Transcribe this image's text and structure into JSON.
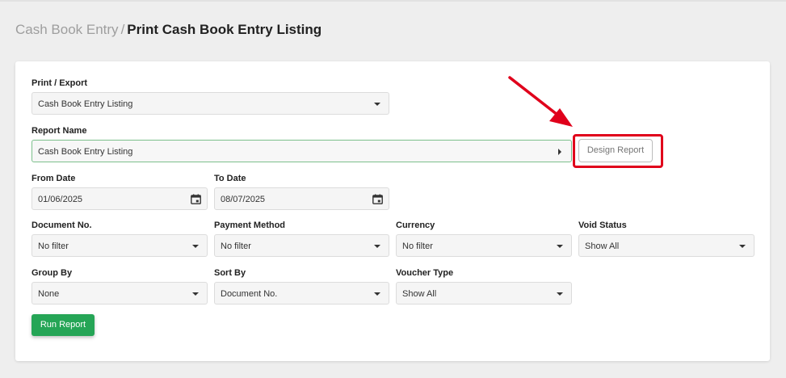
{
  "breadcrumb": {
    "parent": "Cash Book Entry",
    "separator": "/",
    "current": "Print Cash Book Entry Listing"
  },
  "form": {
    "print_export": {
      "label": "Print / Export",
      "value": "Cash Book Entry Listing"
    },
    "report_name": {
      "label": "Report Name",
      "value": "Cash Book Entry Listing"
    },
    "design_report_label": "Design Report",
    "from_date": {
      "label": "From Date",
      "value": "01/06/2025"
    },
    "to_date": {
      "label": "To Date",
      "value": "08/07/2025"
    },
    "document_no": {
      "label": "Document No.",
      "value": "No filter"
    },
    "payment_method": {
      "label": "Payment Method",
      "value": "No filter"
    },
    "currency": {
      "label": "Currency",
      "value": "No filter"
    },
    "void_status": {
      "label": "Void Status",
      "value": "Show All"
    },
    "group_by": {
      "label": "Group By",
      "value": "None"
    },
    "sort_by": {
      "label": "Sort By",
      "value": "Document No."
    },
    "voucher_type": {
      "label": "Voucher Type",
      "value": "Show All"
    },
    "run_report_label": "Run Report"
  },
  "icons": {
    "calendar": "calendar-icon",
    "dropdown": "chevron-down-icon",
    "expand": "chevron-right-icon"
  },
  "colors": {
    "primary_button": "#25a556",
    "highlight": "#e0001b",
    "active_border": "#7cc08c"
  }
}
